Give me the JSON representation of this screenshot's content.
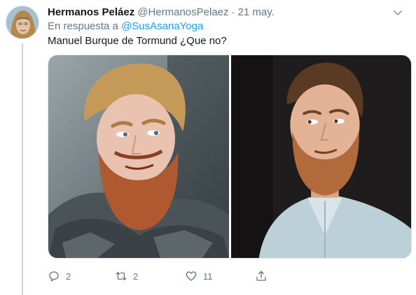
{
  "tweet": {
    "author_name": "Hermanos Peláez",
    "author_handle": "@HermanosPelaez",
    "separator": "·",
    "timestamp": "21 may.",
    "reply_prefix": "En respuesta a",
    "reply_mention": "@SusAsanaYoga",
    "text": "Manuel Burque de Tormund ¿Que no?"
  },
  "media": {
    "photos": [
      "photo-tormund",
      "photo-actor"
    ]
  },
  "actions": {
    "reply_count": "2",
    "retweet_count": "2",
    "like_count": "11"
  },
  "icons": {
    "reply": "comment-icon",
    "retweet": "retweet-icon",
    "like": "heart-icon",
    "share": "share-icon",
    "caret": "chevron-down-icon"
  },
  "colors": {
    "link": "#1da1f2",
    "secondary_text": "#657786",
    "primary_text": "#14171a",
    "thread_line": "#ccd6dd"
  }
}
